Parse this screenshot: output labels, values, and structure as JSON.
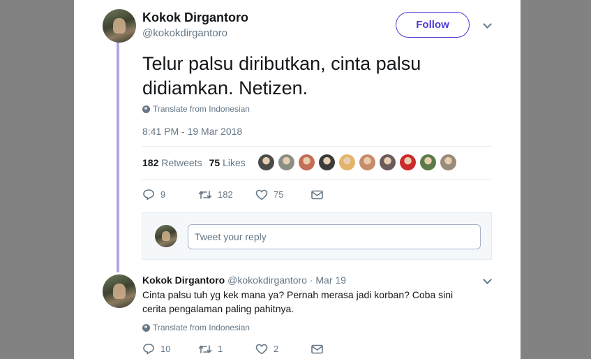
{
  "tweet": {
    "author_name": "Kokok Dirgantoro",
    "author_handle": "@kokokdirgantoro",
    "follow_label": "Follow",
    "text": "Telur palsu diributkan, cinta palsu didiamkan. Netizen.",
    "translate_label": "Translate from Indonesian",
    "timestamp": "8:41 PM - 19 Mar 2018",
    "retweet_count": "182",
    "retweet_label": "Retweets",
    "like_count": "75",
    "like_label": "Likes",
    "liker_avatar_colors": [
      "#4b4b4b",
      "#8a8f86",
      "#c46e57",
      "#3b3b3b",
      "#e2b36a",
      "#c88b6a",
      "#6b5b5b",
      "#cc2b2b",
      "#5d7a4a",
      "#9a8a7a"
    ],
    "actions": {
      "reply_count": "9",
      "retweet_count": "182",
      "like_count": "75"
    }
  },
  "reply_composer": {
    "placeholder": "Tweet your reply"
  },
  "reply": {
    "author_name": "Kokok Dirgantoro",
    "author_handle": "@kokokdirgantoro",
    "date": "· Mar 19",
    "text": "Cinta palsu tuh yg kek mana ya? Pernah merasa jadi korban? Coba sini cerita pengalaman paling pahitnya.",
    "translate_label": "Translate from Indonesian",
    "actions": {
      "reply_count": "10",
      "retweet_count": "1",
      "like_count": "2"
    }
  },
  "colors": {
    "accent": "#4c3bd6",
    "thread_line": "#b6a5e0",
    "secondary_text": "#657786",
    "page_background": "#828282"
  }
}
